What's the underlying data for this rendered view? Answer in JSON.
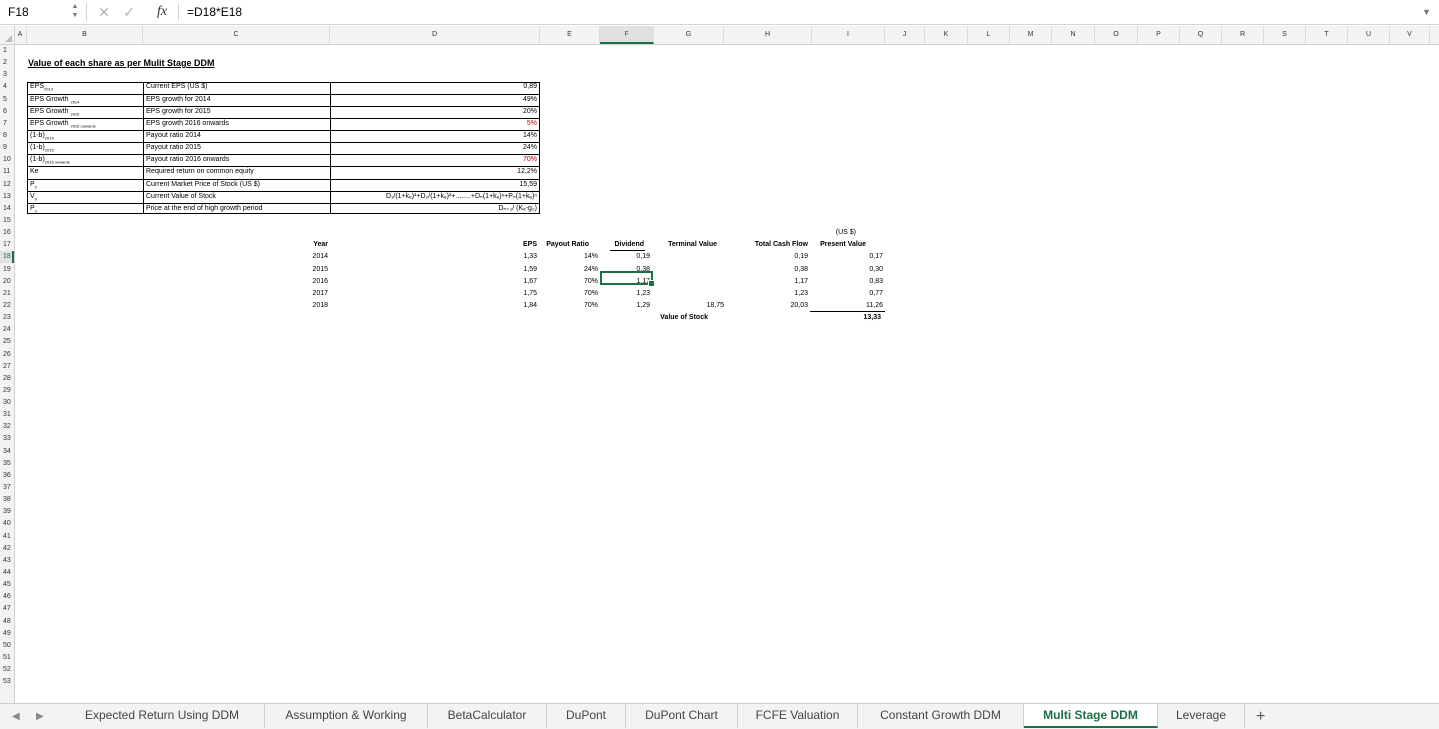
{
  "formula_bar": {
    "cell_ref": "F18",
    "formula": "=D18*E18",
    "fx_label": "fx"
  },
  "columns": [
    "A",
    "B",
    "C",
    "D",
    "E",
    "F",
    "G",
    "H",
    "I",
    "J",
    "K",
    "L",
    "M",
    "N",
    "O",
    "P",
    "Q",
    "R",
    "S",
    "T",
    "U",
    "V"
  ],
  "selected_column": "F",
  "rows": [
    "1",
    "2",
    "3",
    "4",
    "5",
    "6",
    "7",
    "8",
    "9",
    "10",
    "11",
    "12",
    "13",
    "14",
    "15",
    "16",
    "17",
    "18",
    "19",
    "20",
    "21",
    "22",
    "23",
    "24",
    "25",
    "26",
    "27",
    "28",
    "29",
    "30",
    "31",
    "32",
    "33",
    "34",
    "35",
    "36",
    "37",
    "38",
    "39",
    "40",
    "41",
    "42",
    "43",
    "44",
    "45",
    "46",
    "47",
    "48",
    "49",
    "50",
    "51",
    "52",
    "53"
  ],
  "selected_row": "18",
  "title": "Value of each share as per Mulit Stage DDM",
  "assumptions": [
    {
      "label": "EPS",
      "sub": "2013",
      "desc": "Current EPS (US $)",
      "value": "0,89",
      "red": false
    },
    {
      "label": "EPS Growth ",
      "sub": "2014",
      "desc": "EPS growth for 2014",
      "value": "49%",
      "red": false
    },
    {
      "label": "EPS Growth ",
      "sub": "2015",
      "desc": "EPS growth for 2015",
      "value": "20%",
      "red": false
    },
    {
      "label": "EPS Growth ",
      "sub": "2016 onwards",
      "desc": "EPS growth 2016 onwards",
      "value": "5%",
      "red": true
    },
    {
      "label": "(1-b)",
      "sub": "2014",
      "desc": "Payout ratio 2014",
      "value": "14%",
      "red": false
    },
    {
      "label": "(1-b)",
      "sub": "2015",
      "desc": "Payout ratio 2015",
      "value": "24%",
      "red": false
    },
    {
      "label": "(1-b)",
      "sub": "2016 onwards",
      "desc": "Payout ratio 2016 onwards",
      "value": "70%",
      "red": true
    },
    {
      "label": "Ke",
      "sub": "",
      "desc": "Required return on common equity",
      "value": "12,2%",
      "red": false
    },
    {
      "label": "P",
      "sub": "0",
      "desc": "Current Market Price of Stock (US $)",
      "value": "15,59",
      "red": false
    },
    {
      "label": "V",
      "sub": "0",
      "desc": "Current Value of Stock",
      "value": "D₁/(1+kₑ)¹+D₂/(1+kₑ)²+........+Dₙ(1+kₑ)ⁿ+Pₙ(1+kₑ)ⁿ",
      "red": false
    },
    {
      "label": "P",
      "sub": "n",
      "desc": "Price at the end of high growth period",
      "value": "Dₙ₊₁/ (Kₑ-g₂)",
      "red": false
    }
  ],
  "projection": {
    "currency_note": "(US $)",
    "headers": {
      "year": "Year",
      "eps": "EPS",
      "payout": "Payout Ratio",
      "dividend": "Dividend",
      "terminal": "Terminal Value",
      "total_cf": "Total Cash Flow",
      "pv": "Present Value"
    },
    "rows": [
      {
        "year": "2014",
        "eps": "1,33",
        "payout": "14%",
        "dividend": "0,19",
        "terminal": "",
        "total_cf": "0,19",
        "pv": "0,17"
      },
      {
        "year": "2015",
        "eps": "1,59",
        "payout": "24%",
        "dividend": "0,38",
        "terminal": "",
        "total_cf": "0,38",
        "pv": "0,30"
      },
      {
        "year": "2016",
        "eps": "1,67",
        "payout": "70%",
        "dividend": "1,17",
        "terminal": "",
        "total_cf": "1,17",
        "pv": "0,83"
      },
      {
        "year": "2017",
        "eps": "1,75",
        "payout": "70%",
        "dividend": "1,23",
        "terminal": "",
        "total_cf": "1,23",
        "pv": "0,77"
      },
      {
        "year": "2018",
        "eps": "1,84",
        "payout": "70%",
        "dividend": "1,29",
        "terminal": "18,75",
        "total_cf": "20,03",
        "pv": "11,26"
      }
    ],
    "value_label": "Value of Stock",
    "value_total": "13,33"
  },
  "tabs": [
    {
      "label": "Expected Return Using DDM",
      "active": false
    },
    {
      "label": "Assumption & Working",
      "active": false
    },
    {
      "label": "BetaCalculator",
      "active": false
    },
    {
      "label": "DuPont",
      "active": false
    },
    {
      "label": "DuPont Chart",
      "active": false
    },
    {
      "label": "FCFE Valuation",
      "active": false
    },
    {
      "label": "Constant Growth DDM",
      "active": false
    },
    {
      "label": "Multi Stage DDM",
      "active": true
    },
    {
      "label": "Leverage",
      "active": false
    }
  ],
  "colors": {
    "accent": "#1d7044",
    "red": "#c00000"
  }
}
